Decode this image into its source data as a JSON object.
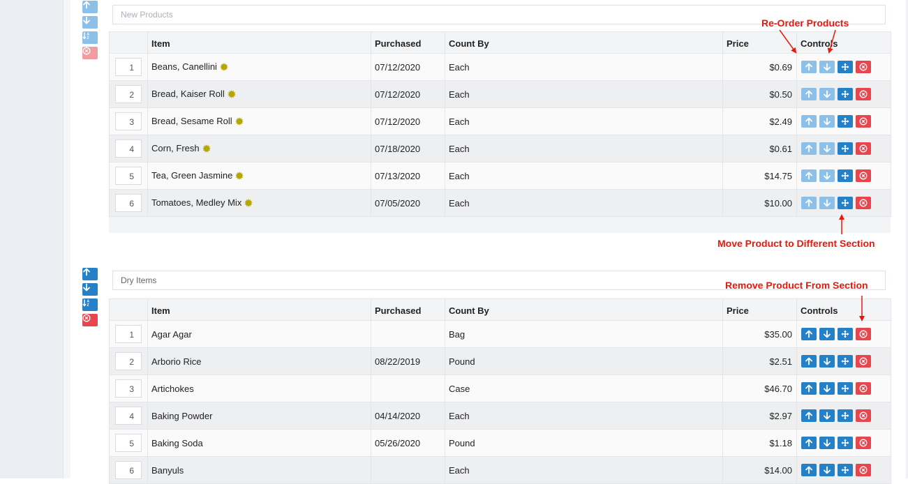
{
  "sections": [
    {
      "title": "",
      "placeholder": "New Products",
      "controls_muted": true,
      "columns": {
        "item": "Item",
        "purchased": "Purchased",
        "count_by": "Count By",
        "price": "Price",
        "controls": "Controls"
      },
      "rows": [
        {
          "index": "1",
          "item": "Beans, Canellini",
          "purchased": "07/12/2020",
          "count_by": "Each",
          "price": "$0.69",
          "new": true
        },
        {
          "index": "2",
          "item": "Bread, Kaiser Roll",
          "purchased": "07/12/2020",
          "count_by": "Each",
          "price": "$0.50",
          "new": true
        },
        {
          "index": "3",
          "item": "Bread, Sesame Roll",
          "purchased": "07/12/2020",
          "count_by": "Each",
          "price": "$2.49",
          "new": true
        },
        {
          "index": "4",
          "item": "Corn, Fresh",
          "purchased": "07/18/2020",
          "count_by": "Each",
          "price": "$0.61",
          "new": true
        },
        {
          "index": "5",
          "item": "Tea, Green Jasmine",
          "purchased": "07/13/2020",
          "count_by": "Each",
          "price": "$14.75",
          "new": true
        },
        {
          "index": "6",
          "item": "Tomatoes, Medley Mix",
          "purchased": "07/05/2020",
          "count_by": "Each",
          "price": "$10.00",
          "new": true
        }
      ]
    },
    {
      "title": "Dry Items",
      "placeholder": "",
      "controls_muted": false,
      "columns": {
        "item": "Item",
        "purchased": "Purchased",
        "count_by": "Count By",
        "price": "Price",
        "controls": "Controls"
      },
      "rows": [
        {
          "index": "1",
          "item": "Agar Agar",
          "purchased": "",
          "count_by": "Bag",
          "price": "$35.00",
          "new": false
        },
        {
          "index": "2",
          "item": "Arborio Rice",
          "purchased": "08/22/2019",
          "count_by": "Pound",
          "price": "$2.51",
          "new": false
        },
        {
          "index": "3",
          "item": "Artichokes",
          "purchased": "",
          "count_by": "Case",
          "price": "$46.70",
          "new": false
        },
        {
          "index": "4",
          "item": "Baking Powder",
          "purchased": "04/14/2020",
          "count_by": "Each",
          "price": "$2.97",
          "new": false
        },
        {
          "index": "5",
          "item": "Baking Soda",
          "purchased": "05/26/2020",
          "count_by": "Pound",
          "price": "$1.18",
          "new": false
        },
        {
          "index": "6",
          "item": "Banyuls",
          "purchased": "",
          "count_by": "Each",
          "price": "$14.00",
          "new": false
        }
      ]
    }
  ],
  "annotations": {
    "reorder": "Re-Order Products",
    "move": "Move Product to Different Section",
    "remove": "Remove Product From Section"
  },
  "icons": {
    "move_up": "arrow-up-icon",
    "move_down": "arrow-down-icon",
    "sort": "sort-az-icon",
    "move_section": "move-arrows-icon",
    "remove": "close-circle-icon",
    "new": "starburst-icon"
  },
  "colors": {
    "blue": "#2481c7",
    "blue_muted": "#8cc0e8",
    "red": "#e8464f",
    "red_muted": "#f19ca1",
    "new_badge": "#b5a500",
    "annotation": "#e8180c"
  }
}
